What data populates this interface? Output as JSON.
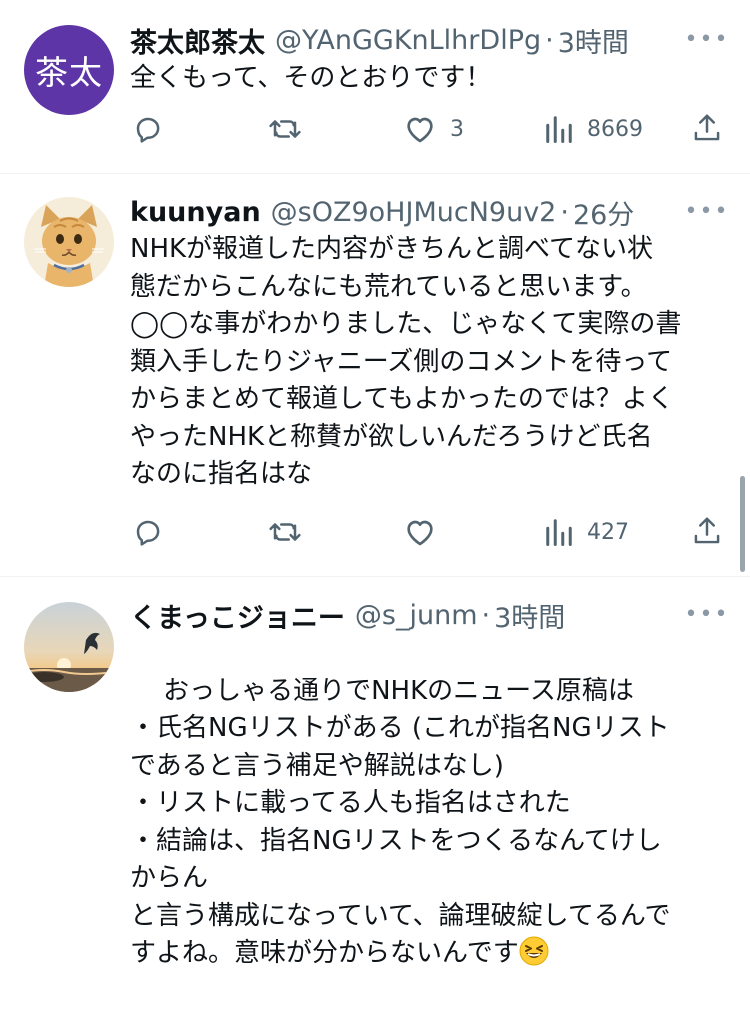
{
  "tweets": [
    {
      "avatar_text": "茶太",
      "name": "茶太郎茶太",
      "handle": "@YAnGGKnLlhrDlPg",
      "separator": "·",
      "time": "3時間",
      "more": "•••",
      "text": "全くもって、そのとおりです！",
      "replies": "",
      "retweets": "",
      "likes": "3",
      "views": "8669"
    },
    {
      "avatar_icon": "cat-avatar-icon",
      "name": "kuunyan",
      "handle": "@sOZ9oHJMucN9uv2",
      "separator": "·",
      "time": "26分",
      "more": "•••",
      "text": "NHKが報道した内容がきちんと調べてない状\n態だからこんなにも荒れていると思います。\n◯◯な事がわかりました、じゃなくて実際の書\n類入手したりジャニーズ側のコメントを待って\nからまとめて報道してもよかったのでは？よく\nやったNHKと称賛が欲しいんだろうけど氏名\nなのに指名はな",
      "replies": "",
      "retweets": "",
      "likes": "",
      "views": "427"
    },
    {
      "avatar_icon": "sunset-dolphin-avatar-icon",
      "name": "くまっこジョニー",
      "handle": "@s_junm",
      "separator": "·",
      "time": "3時間",
      "more": "•••",
      "text": "おっしゃる通りでNHKのニュース原稿は\n・氏名NGリストがある (これが指名NGリスト\nであると言う補足や解説はなし)\n・リストに載ってる人も指名はされた\n・結論は、指名NGリストをつくるなんてけし\nからん\nと言う構成になっていて、論理破綻してるんで\nすよね。意味が分からないんです"
    }
  ],
  "colors": {
    "text": "#0f1419",
    "secondary": "#536471",
    "divider": "#eff3f4",
    "avatar_purple": "#5d35a6"
  }
}
